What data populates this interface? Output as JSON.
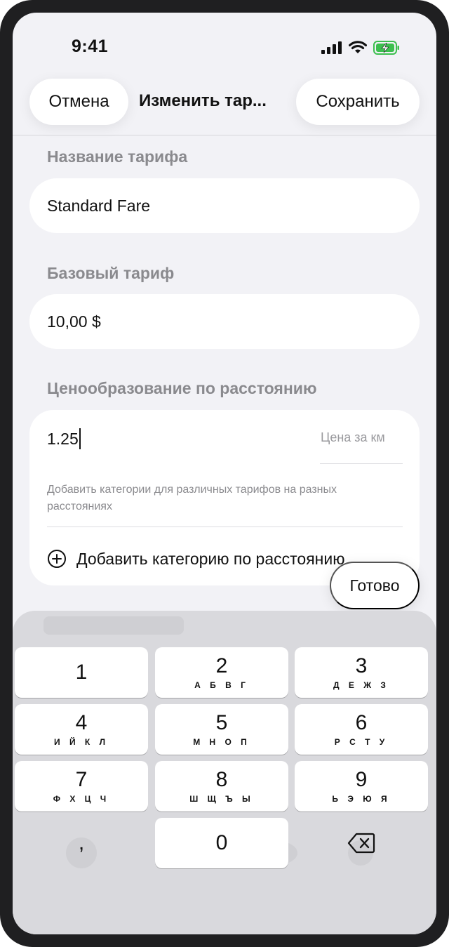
{
  "status_bar": {
    "time": "9:41"
  },
  "nav": {
    "cancel_label": "Отмена",
    "title": "Изменить тар...",
    "save_label": "Сохранить"
  },
  "form": {
    "fare_name": {
      "label": "Название тарифа",
      "value": "Standard Fare"
    },
    "base_fare": {
      "label": "Базовый тариф",
      "value": "10,00 $"
    },
    "distance_pricing": {
      "label": "Ценообразование по расстоянию",
      "price_value": "1.25",
      "price_placeholder": "Цена за км",
      "hint": "Добавить категории для различных тарифов на разных расстояниях",
      "add_tier_label": "Добавить категорию по расстоянию"
    }
  },
  "done_label": "Готово",
  "keyboard": {
    "keys": [
      {
        "digit": "1",
        "letters": ""
      },
      {
        "digit": "2",
        "letters": "А Б В Г"
      },
      {
        "digit": "3",
        "letters": "Д Е Ж З"
      },
      {
        "digit": "4",
        "letters": "И Й К Л"
      },
      {
        "digit": "5",
        "letters": "М Н О П"
      },
      {
        "digit": "6",
        "letters": "Р С Т У"
      },
      {
        "digit": "7",
        "letters": "Ф Х Ц Ч"
      },
      {
        "digit": "8",
        "letters": "Ш Щ Ъ Ы"
      },
      {
        "digit": "9",
        "letters": "Ь Э Ю Я"
      }
    ],
    "comma": ",",
    "zero": "0"
  },
  "colors": {
    "background": "#f2f2f6",
    "surface": "#ffffff",
    "secondary_text": "#8a8a8e",
    "keyboard": "#d9d9dd"
  }
}
